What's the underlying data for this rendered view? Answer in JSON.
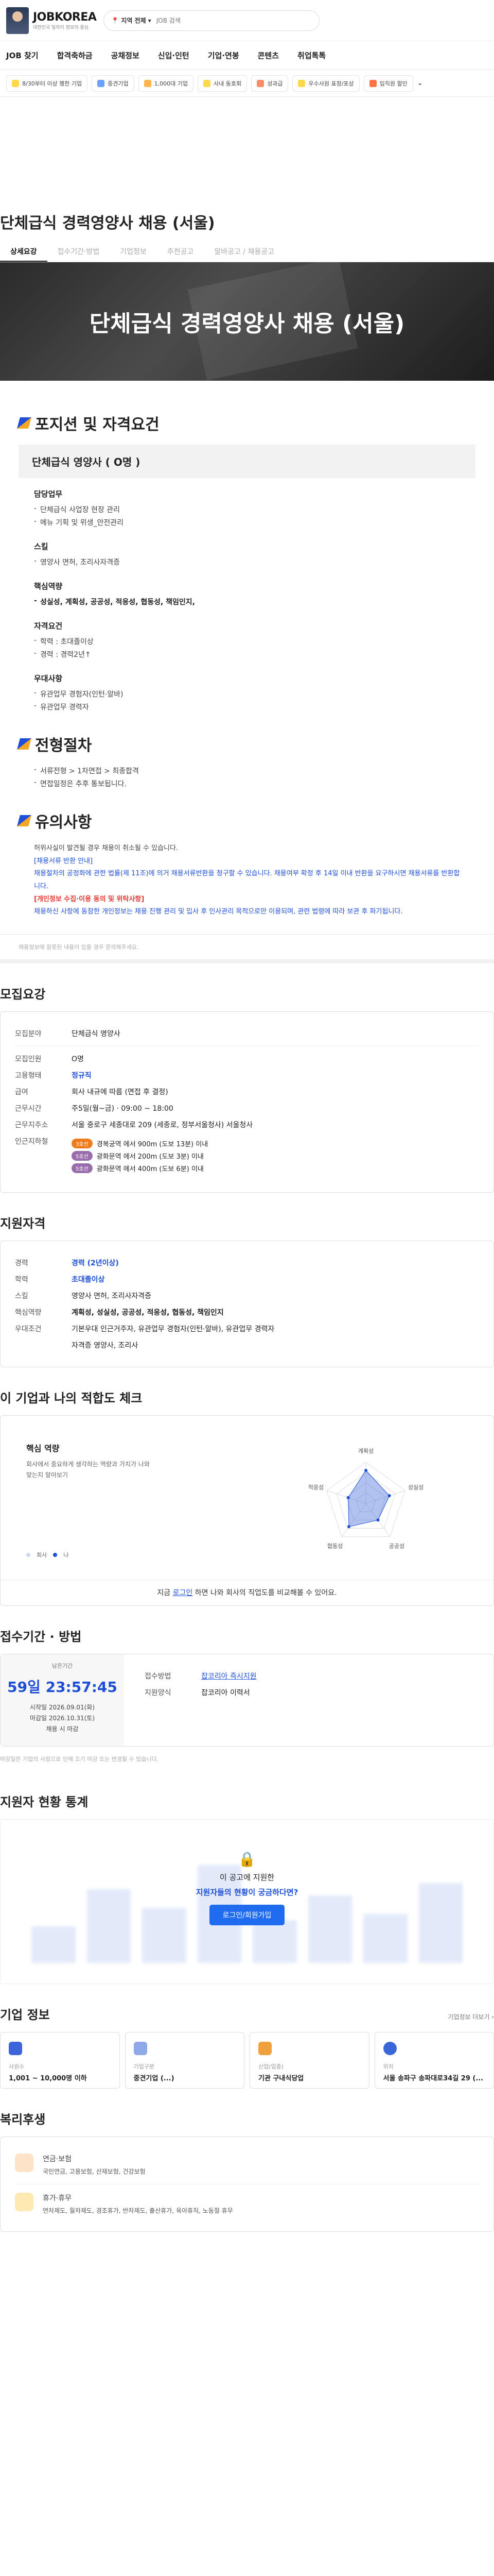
{
  "header": {
    "logo": "JOBKOREA",
    "logo_sub": "대한민국 일자리 정보의 중심",
    "location_label": "지역 전체",
    "search_placeholder": "JOB 검색"
  },
  "gnb": [
    "JOB 찾기",
    "합격축하금",
    "공채정보",
    "신입·인턴",
    "기업·연봉",
    "콘텐츠",
    "취업톡톡"
  ],
  "chips": [
    "8/30부터 이상 행한 기업",
    "중견기업",
    "1,000대 기업",
    "사내 동호회",
    "성과급",
    "우수사원 표창/포상",
    "입직원 할인"
  ],
  "job": {
    "title": "단체급식 경력영양사 채용 (서울)",
    "tabs": [
      "상세요강",
      "접수기간·방법",
      "기업정보",
      "추천공고",
      "알바공고 / 채용공고"
    ],
    "banner_title": "단체급식 경력영양사 채용 (서울)"
  },
  "detail": {
    "sec1": "포지션 및 자격요건",
    "position": "단체급식 영양사 ( O명 )",
    "blocks": [
      {
        "h": "담당업무",
        "items": [
          "단체급식 사업장 현장 관리",
          "메뉴 기획 및 위생_안전관리"
        ]
      },
      {
        "h": "스킬",
        "items": [
          "영양사 면허, 조리사자격증"
        ]
      },
      {
        "h": "핵심역량",
        "items": [
          "성실성, 계획성, 공공성, 적응성, 협동성, 책임인지,"
        ]
      },
      {
        "h": "자격요건",
        "items": [
          "학력 : 초대졸이상",
          "경력 : 경력2년↑"
        ]
      },
      {
        "h": "우대사항",
        "items": [
          "유관업무 경험자(인턴·알바)",
          "유관업무 경력자"
        ]
      }
    ],
    "sec2": "전형절차",
    "process": [
      "서류전형 > 1차면접 > 최종합격",
      "면접일정은 추후 통보됩니다."
    ],
    "sec3": "유의사항",
    "notice1": "허위사실이 발견될 경우 채용이 취소될 수 있습니다.",
    "notice_blue_h": "[채용서류 반환 안내]",
    "notice_text": "채용절차의 공정화에 관한 법률(제 11조)에 의거 채용서류반환을 청구할 수 있습니다. 채용여부 확정 후 14일 이내 반환을 요구하시면 채용서류를 반환합니다.",
    "notice_red_h": "[개인정보 수집·이용 동의 및 위탁사항]",
    "notice_text2": "채용하신 사항에 동참한 개인정보는 채용 진행 관리 및 입사 후 인사관리 목적으로만 이용되며, 관련 법령에 따라 보관 후 파기됩니다.",
    "footnote": "채용정보에 잘못된 내용이 있을 경우 문의해주세요."
  },
  "summary": {
    "h": "모집요강",
    "rows": [
      {
        "k": "모집분야",
        "v": "단체급식 영양사"
      },
      {
        "k": "모집인원",
        "v": "O명"
      },
      {
        "k": "고용형태",
        "v": "정규직"
      },
      {
        "k": "급여",
        "v": "회사 내규에 따름 (면접 후 결정)"
      },
      {
        "k": "근무시간",
        "v": "주5일(월~금) · 09:00 ~ 18:00"
      },
      {
        "k": "근무지주소",
        "v": "서울 중로구 세종대로 209 (세종로, 정부서울청사) 서울청사"
      }
    ],
    "subway_k": "인근지하철",
    "subway": [
      {
        "line": "3호선",
        "color": "#ef7c1c",
        "text": "경복궁역 에서 900m (도보 13분) 이내"
      },
      {
        "line": "5호선",
        "color": "#996cac",
        "text": "광화문역 에서 200m (도보 3분) 이내"
      },
      {
        "line": "5호선",
        "color": "#996cac",
        "text": "광화문역 에서 400m (도보 6분) 이내"
      }
    ]
  },
  "qual": {
    "h": "지원자격",
    "rows": [
      {
        "k": "경력",
        "v": "경력 (2년이상)"
      },
      {
        "k": "학력",
        "v": "초대졸이상"
      },
      {
        "k": "스킬",
        "v": "영양사 면허, 조리사자격증"
      },
      {
        "k": "핵심역량",
        "v": "계획성, 성실성, 공공성, 적응성, 협동성, 책임인지"
      },
      {
        "k": "우대조건",
        "v": "기본우대 인근거주자, 유관업무 경험자(인턴·알바), 유관업무 경력자"
      },
      {
        "k": "",
        "v": "자격증 영양사, 조리사"
      }
    ]
  },
  "fit": {
    "h": "이 기업과 나의 적합도 체크",
    "core": "핵심 역량",
    "desc": "회사에서 중요하게 생각하는 역량과 가치가 나와 맞는지 알아보기",
    "axes": [
      "계획성",
      "성실성",
      "공공성",
      "협동성",
      "적응성"
    ],
    "legend_company": "회사",
    "legend_me": "나",
    "login_pre": "지금 ",
    "login_link": "로그인",
    "login_post": " 하면 나와 회사의 직업도를 비교해볼 수 있어요."
  },
  "chart_data": {
    "type": "radar",
    "categories": [
      "계획성",
      "성실성",
      "공공성",
      "협동성",
      "적응성"
    ],
    "series": [
      {
        "name": "회사",
        "values": [
          0.8,
          0.6,
          0.5,
          0.7,
          0.45
        ]
      }
    ],
    "title": "",
    "ylim": [
      0,
      1
    ]
  },
  "apply": {
    "h": "접수기간 · 방법",
    "remain_label": "남은기간",
    "remain": "59일 23:57:45",
    "start_k": "시작일",
    "start": "2026.09.01(화)",
    "end_k": "마감일",
    "end": "2026.10.31(토)",
    "note": "채용 시 마감",
    "method_k": "접수방법",
    "method": "잡코리아 즉시지원",
    "form_k": "지원양식",
    "form": "잡코리아 이력서",
    "footnote": "마감일은 기업의 사정으로 인해 조기 마감 또는 변경될 수 있습니다."
  },
  "stats": {
    "h": "지원자 현황 통계",
    "q": "이 공고에 지원한",
    "q2": "지원자들의 현황이 궁금하다면?",
    "btn": "로그인/회원가입"
  },
  "company": {
    "h": "기업 정보",
    "more": "기업정보 더보기 ›",
    "items": [
      {
        "k": "사원수",
        "v": "1,001 ~ 10,000명 이하"
      },
      {
        "k": "기업구분",
        "v": "중견기업 (...)"
      },
      {
        "k": "산업(업종)",
        "v": "기관 구내식당업"
      },
      {
        "k": "위치",
        "v": "서울 송파구 송파대로34길 29 (..."
      }
    ]
  },
  "benefit": {
    "h": "복리후생",
    "items": [
      {
        "k": "연금·보험",
        "v": "국민연금, 고용보험, 산재보험, 건강보험"
      },
      {
        "k": "휴가·휴무",
        "v": "연차제도, 월차제도, 경조휴가, 반차제도, 출산휴가, 육아휴직, 노동절 휴무"
      }
    ]
  }
}
